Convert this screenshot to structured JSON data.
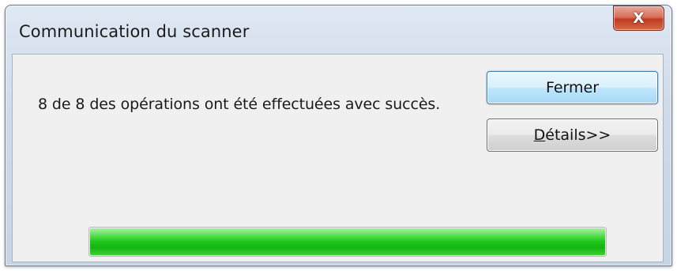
{
  "window": {
    "title": "Communication du scanner",
    "close_glyph": "X",
    "close_icon": "close-icon"
  },
  "dialog": {
    "message": "8 de 8 des opérations ont été effectuées avec succès.",
    "close_label": "Fermer",
    "details_label_accel": "D",
    "details_label_rest": "étails>>"
  },
  "progress": {
    "fraction": 1.0
  },
  "colors": {
    "progress_fill": "#13b60f",
    "default_button_border": "#3c7fb1",
    "close_button": "#c03a20"
  }
}
